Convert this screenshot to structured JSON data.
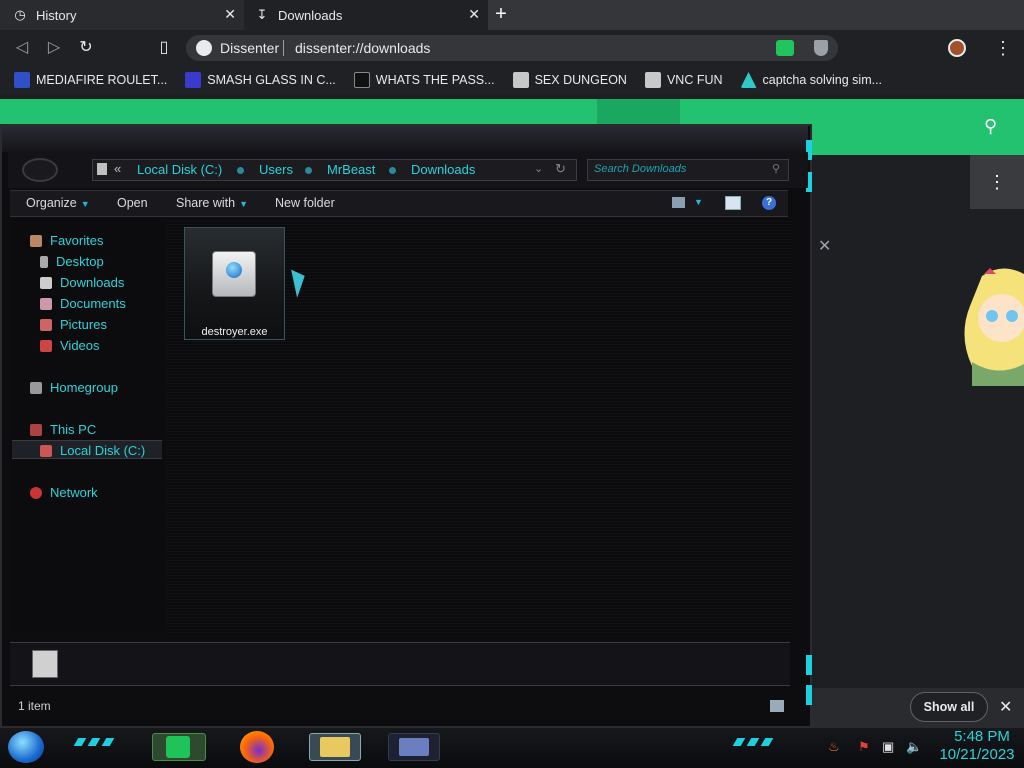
{
  "browser": {
    "tabs": [
      {
        "label": "History",
        "icon": "history-icon"
      },
      {
        "label": "Downloads",
        "icon": "download-icon"
      }
    ],
    "new_tab": "+",
    "site_name": "Dissenter",
    "url": "dissenter://downloads",
    "bookmarks": [
      {
        "label": "MEDIAFIRE ROULET...",
        "icon_color": "#3050c8"
      },
      {
        "label": "SMASH GLASS IN C...",
        "icon_color": "#3a3acc"
      },
      {
        "label": "WHATS THE PASS...",
        "icon_color": "#111111"
      },
      {
        "label": "SEX DUNGEON",
        "icon_color": "#c8c8c8"
      },
      {
        "label": "VNC FUN",
        "icon_color": "#c8c8c8"
      },
      {
        "label": "captcha solving sim...",
        "icon_color": "#30c8c8"
      }
    ]
  },
  "page": {
    "show_all": "Show all",
    "accent": "#23c271"
  },
  "explorer": {
    "breadcrumb": [
      "Local Disk (C:)",
      "Users",
      "MrBeast",
      "Downloads"
    ],
    "breadcrumb_prefix": "«",
    "search_placeholder": "Search Downloads",
    "commands": {
      "organize": "Organize",
      "open": "Open",
      "share_with": "Share with",
      "new_folder": "New folder"
    },
    "nav": {
      "favorites": "Favorites",
      "desktop": "Desktop",
      "downloads": "Downloads",
      "documents": "Documents",
      "pictures": "Pictures",
      "videos": "Videos",
      "homegroup": "Homegroup",
      "this_pc": "This PC",
      "local_disk": "Local Disk (C:)",
      "network": "Network"
    },
    "files": [
      {
        "name": "destroyer.exe"
      }
    ],
    "status": "1 item"
  },
  "taskbar": {
    "time": "5:48 PM",
    "date": "10/21/2023"
  }
}
